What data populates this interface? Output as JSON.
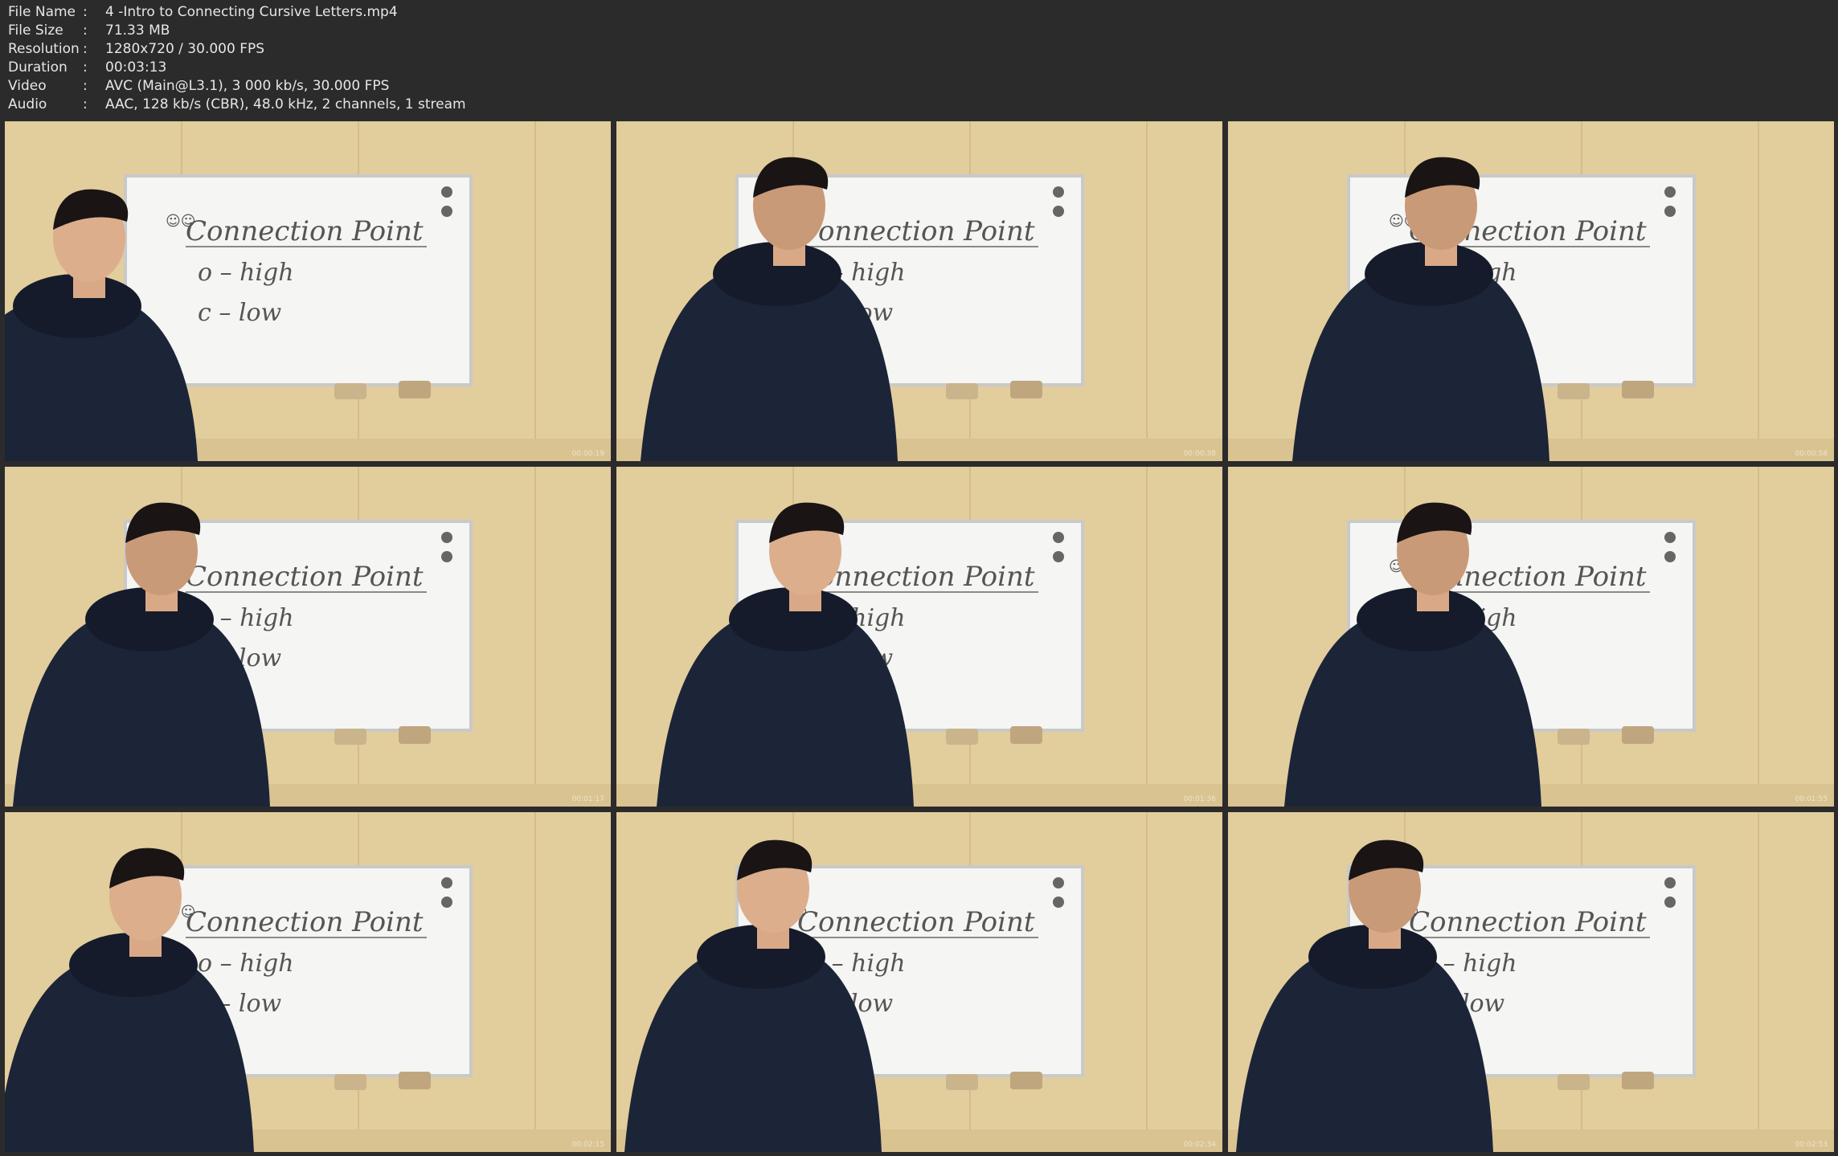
{
  "media_info": {
    "rows": [
      {
        "label": "File Name",
        "sep": ":",
        "value": "4 -Intro to Connecting Cursive Letters.mp4"
      },
      {
        "label": "File Size",
        "sep": ":",
        "value": "71.33 MB"
      },
      {
        "label": "Resolution",
        "sep": ":",
        "value": "1280x720 / 30.000 FPS"
      },
      {
        "label": "Duration",
        "sep": ":",
        "value": "00:03:13"
      },
      {
        "label": "Video",
        "sep": ":",
        "value": "AVC (Main@L3.1), 3 000 kb/s, 30.000 FPS"
      },
      {
        "label": "Audio",
        "sep": ":",
        "value": "AAC, 128 kb/s (CBR), 48.0 kHz, 2 channels, 1 stream"
      }
    ]
  },
  "whiteboard": {
    "title": "Connection Point",
    "line1": "o – high",
    "line2": "c – low",
    "smiley": "☺☺"
  },
  "thumbnails": [
    {
      "label": "frame-1",
      "timestamp": "00:00:19"
    },
    {
      "label": "frame-2",
      "timestamp": "00:00:38"
    },
    {
      "label": "frame-3",
      "timestamp": "00:00:58"
    },
    {
      "label": "frame-4",
      "timestamp": "00:01:17"
    },
    {
      "label": "frame-5",
      "timestamp": "00:01:36"
    },
    {
      "label": "frame-6",
      "timestamp": "00:01:55"
    },
    {
      "label": "frame-7",
      "timestamp": "00:02:15"
    },
    {
      "label": "frame-8",
      "timestamp": "00:02:34"
    },
    {
      "label": "frame-9",
      "timestamp": "00:02:53"
    }
  ],
  "colors": {
    "background": "#2b2b2b",
    "wall": "#e2cd9d",
    "board": "#f5f5f3",
    "jacket": "#1c2438",
    "text": "#e6e6e6"
  }
}
